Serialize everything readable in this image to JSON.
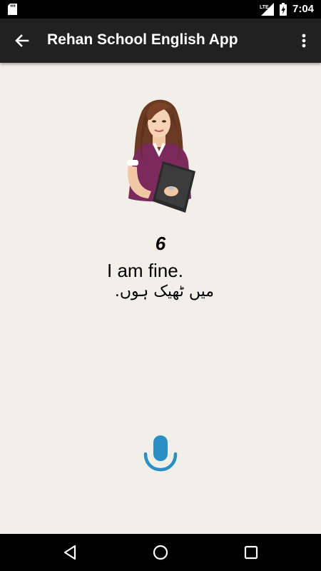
{
  "status_bar": {
    "network": "LTE",
    "time": "7:04"
  },
  "app_bar": {
    "title": "Rehan School English App",
    "back_icon": "arrow-back-icon",
    "menu_icon": "more-vert-icon"
  },
  "lesson": {
    "number": "6",
    "english": "I am fine.",
    "urdu": "میں ٹھیک ہوں."
  },
  "mic": {
    "icon": "microphone-icon",
    "color": "#2a8fc4"
  },
  "nav_bar": {
    "icons": [
      "back-triangle-icon",
      "home-circle-icon",
      "recents-square-icon"
    ]
  }
}
